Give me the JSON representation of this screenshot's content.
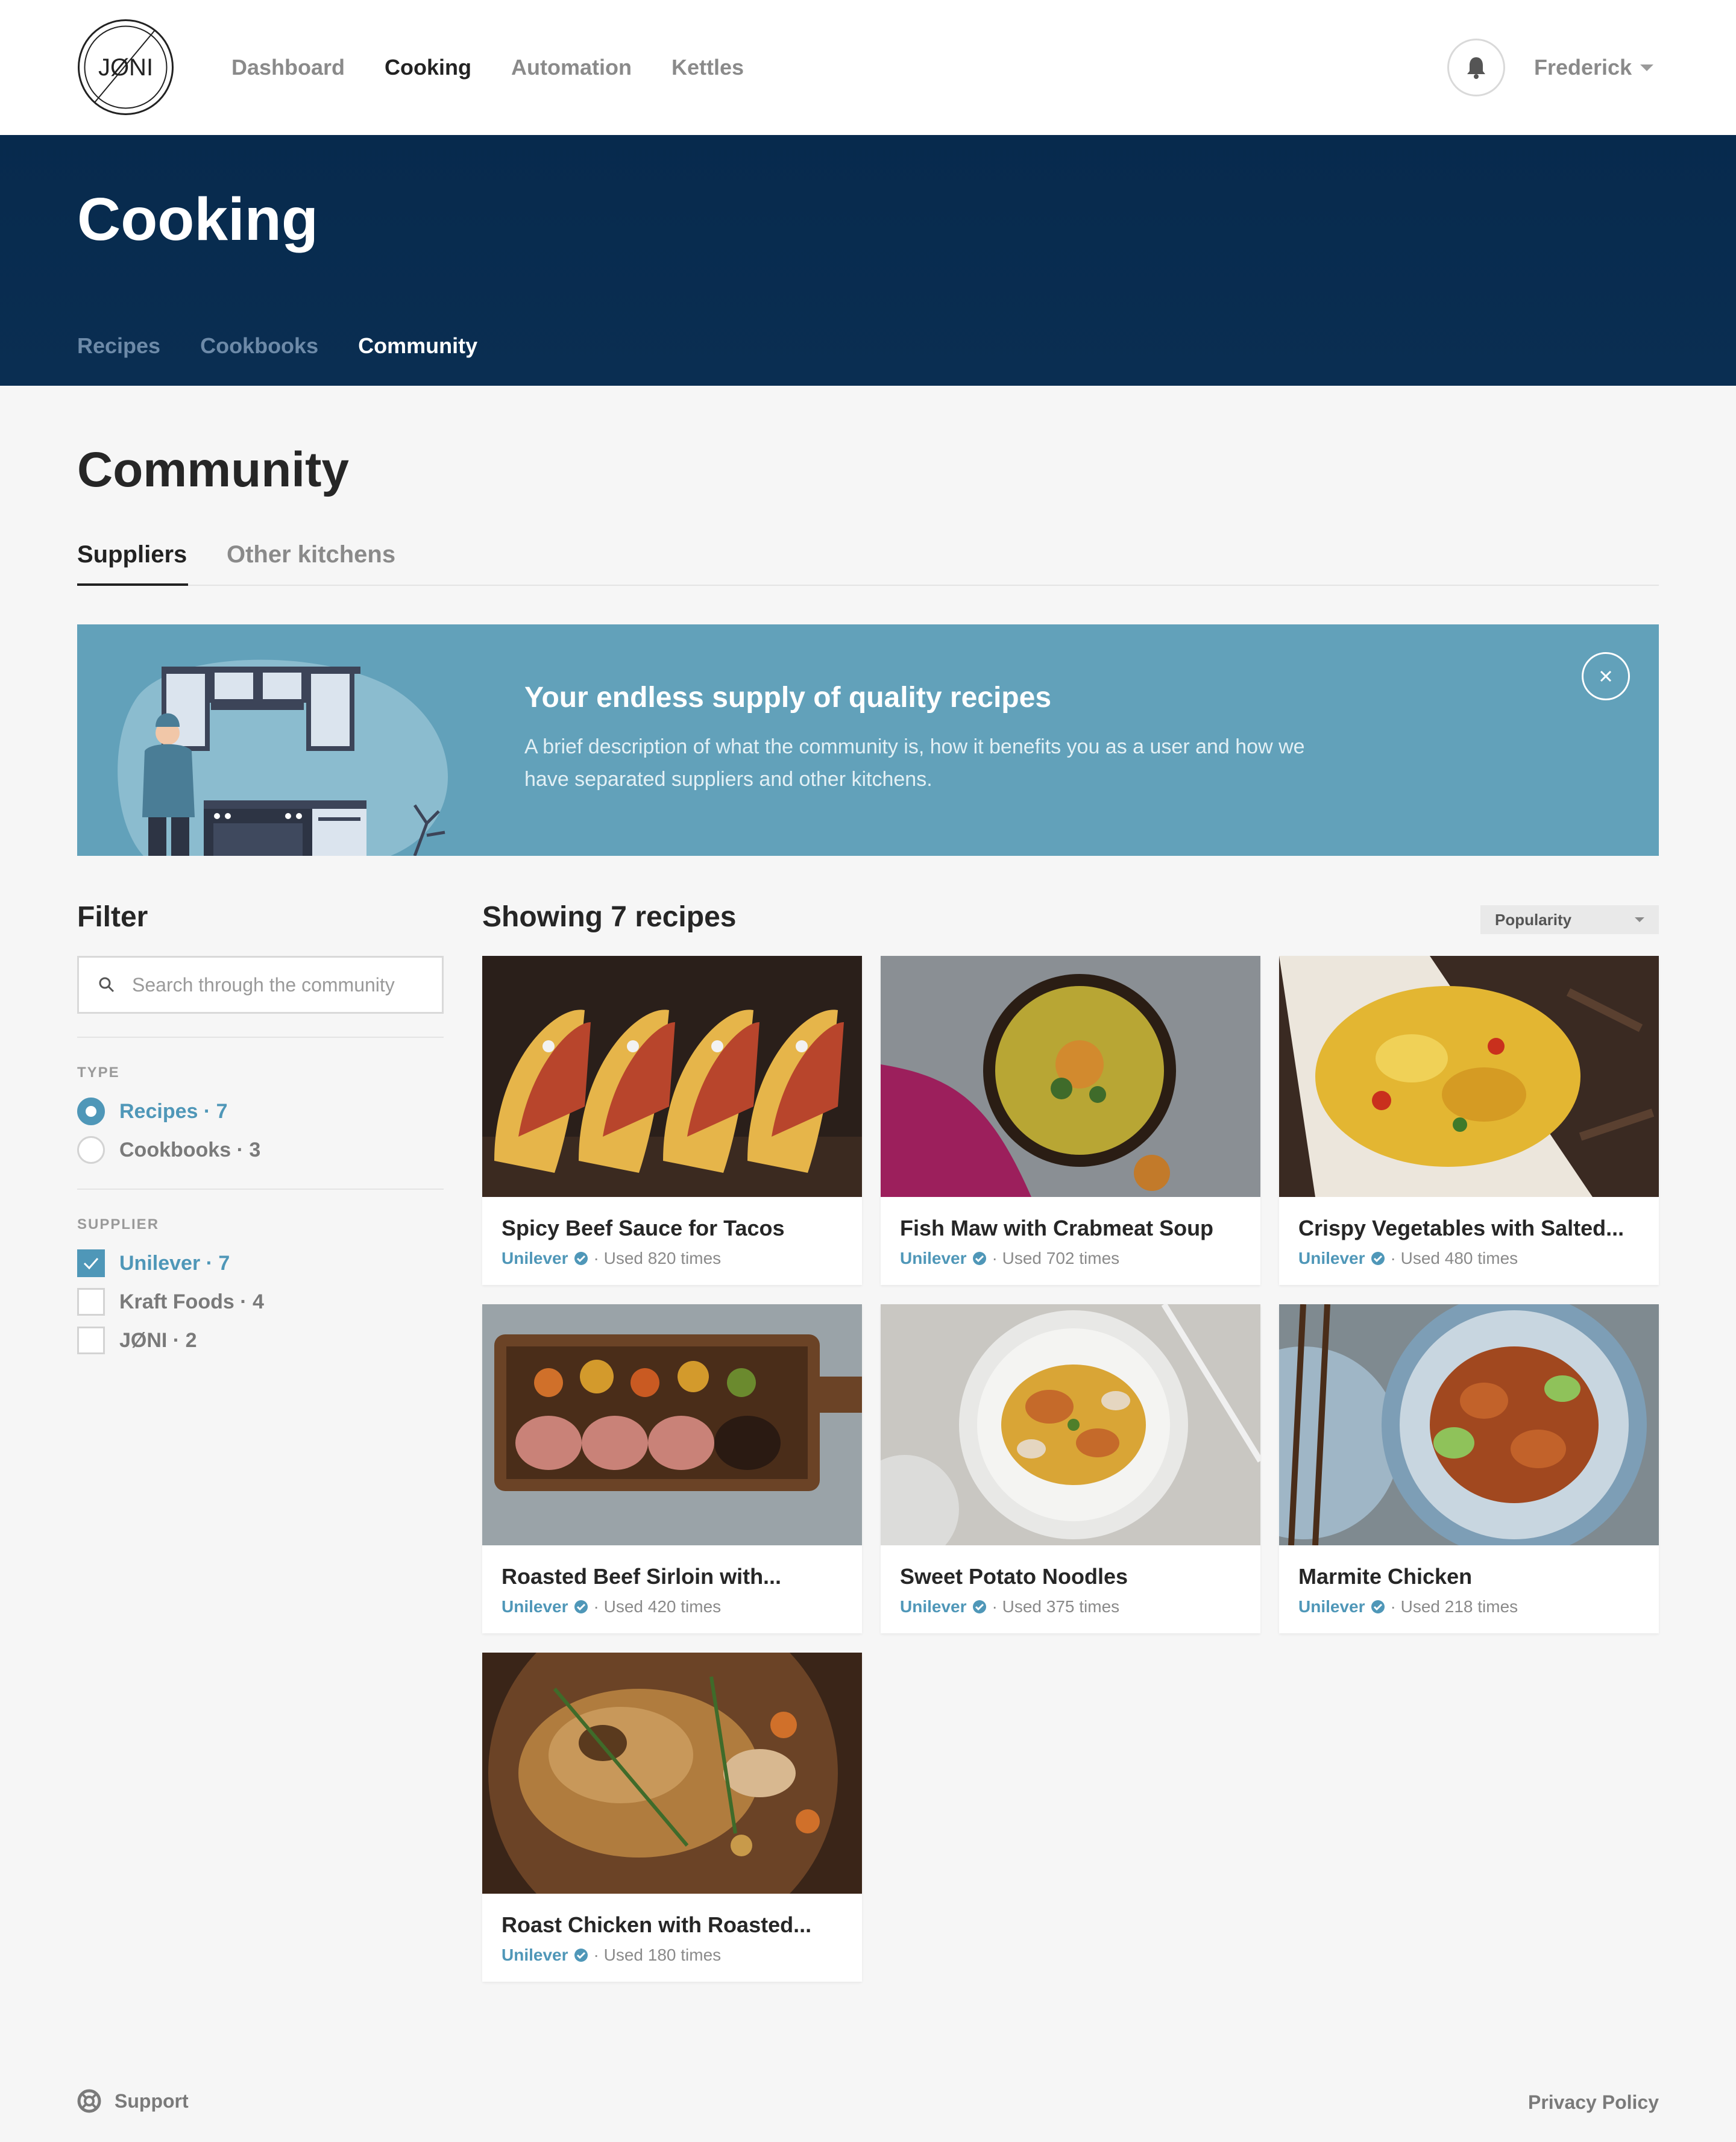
{
  "brand": {
    "logo_text": "JØNI"
  },
  "nav": {
    "items": [
      {
        "label": "Dashboard"
      },
      {
        "label": "Cooking"
      },
      {
        "label": "Automation"
      },
      {
        "label": "Kettles"
      }
    ],
    "active": "Cooking"
  },
  "user": {
    "name": "Frederick"
  },
  "hero": {
    "title": "Cooking",
    "subnav": [
      {
        "label": "Recipes"
      },
      {
        "label": "Cookbooks"
      },
      {
        "label": "Community"
      }
    ],
    "active_subnav": "Community"
  },
  "page": {
    "title": "Community",
    "tabs": [
      {
        "label": "Suppliers"
      },
      {
        "label": "Other kitchens"
      }
    ],
    "active_tab": "Suppliers"
  },
  "banner": {
    "title": "Your endless supply of quality recipes",
    "description": "A brief description of what the community is, how it benefits you as a user and how we have separated suppliers and other kitchens."
  },
  "filter": {
    "title": "Filter",
    "search_placeholder": "Search through the community",
    "type_label": "TYPE",
    "type_options": [
      {
        "label": "Recipes · 7",
        "selected": true
      },
      {
        "label": "Cookbooks · 3",
        "selected": false
      }
    ],
    "supplier_label": "SUPPLIER",
    "supplier_options": [
      {
        "label": "Unilever · 7",
        "checked": true
      },
      {
        "label": "Kraft Foods · 4",
        "checked": false
      },
      {
        "label": "JØNI · 2",
        "checked": false
      }
    ]
  },
  "results": {
    "title": "Showing 7 recipes",
    "sort_value": "Popularity",
    "recipes": [
      {
        "title": "Spicy Beef Sauce for Tacos",
        "supplier": "Unilever",
        "used": "Used 820 times"
      },
      {
        "title": "Fish Maw with Crabmeat Soup",
        "supplier": "Unilever",
        "used": "Used 702 times"
      },
      {
        "title": "Crispy Vegetables with Salted...",
        "supplier": "Unilever",
        "used": "Used 480 times"
      },
      {
        "title": "Roasted Beef Sirloin with...",
        "supplier": "Unilever",
        "used": "Used 420 times"
      },
      {
        "title": "Sweet Potato Noodles",
        "supplier": "Unilever",
        "used": "Used 375 times"
      },
      {
        "title": "Marmite Chicken",
        "supplier": "Unilever",
        "used": "Used 218 times"
      },
      {
        "title": "Roast Chicken with Roasted...",
        "supplier": "Unilever",
        "used": "Used 180 times"
      }
    ]
  },
  "footer": {
    "support_label": "Support",
    "privacy_label": "Privacy Policy"
  },
  "colors": {
    "accent": "#4f97b8",
    "hero_bg": "#072a4d",
    "banner_bg": "#62a1ba",
    "page_bg": "#f6f6f6"
  }
}
